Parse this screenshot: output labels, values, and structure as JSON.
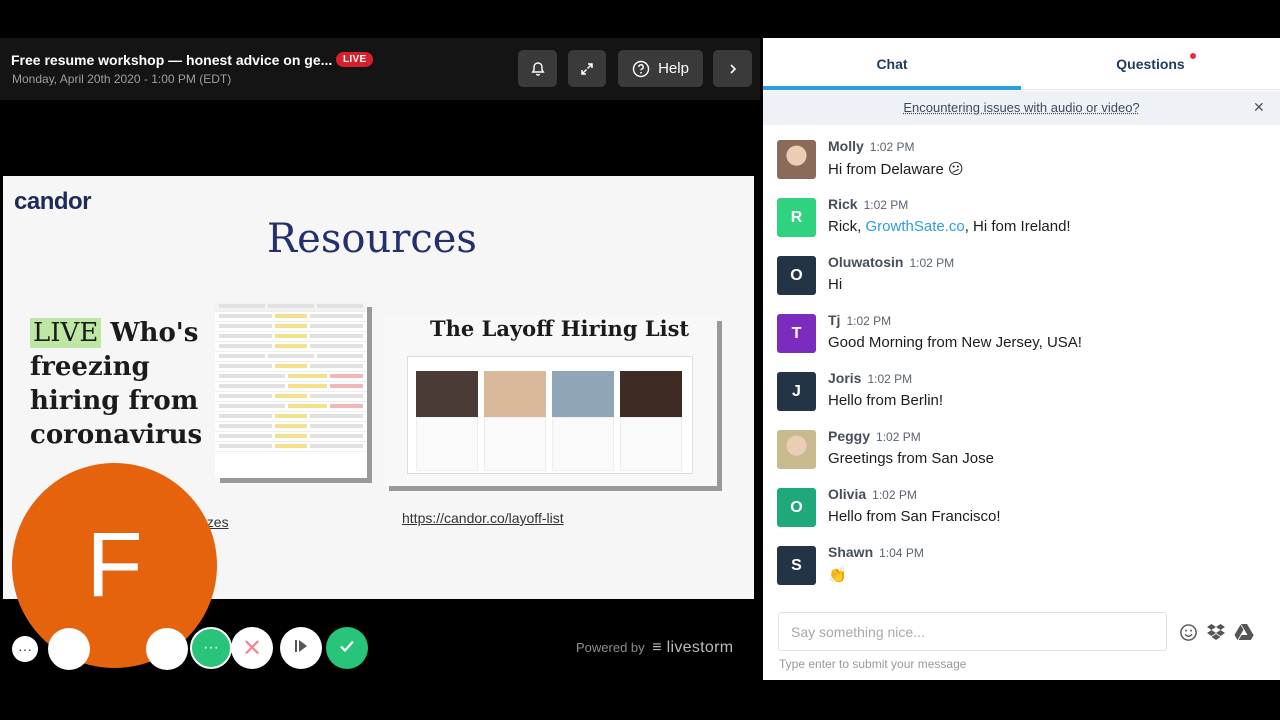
{
  "event": {
    "title": "Free resume workshop — honest advice on ge...",
    "live_badge": "LIVE",
    "date": "Monday, April 20th 2020 - 1:00 PM (EDT)",
    "help_label": "Help"
  },
  "slide": {
    "logo": "candor",
    "title": "Resources",
    "article_live": "LIVE",
    "article_rest": " Who's freezing hiring from coronavirus",
    "layoff_title": "The Layoff Hiring List",
    "link_layoff": "https://candor.co/layoff-list",
    "link_freezes": "ezes"
  },
  "presenter": {
    "avatar_letter": "F",
    "avatar_color": "#e5630d"
  },
  "controls": {
    "more_label": "···",
    "chat_label": "···",
    "close_label": "✕"
  },
  "powered": {
    "prefix": "Powered by",
    "brand": "livestorm"
  },
  "chat": {
    "tabs": [
      {
        "label": "Chat",
        "active": true
      },
      {
        "label": "Questions",
        "active": false,
        "has_notification": true
      }
    ],
    "notice": "Encountering issues with audio or video?",
    "messages": [
      {
        "name": "Molly",
        "time": "1:02 PM",
        "text": "Hi from Delaware 😕",
        "avatar": "photo",
        "color": "#8a6b5a"
      },
      {
        "name": "Rick",
        "time": "1:02 PM",
        "text_before": "Rick, ",
        "link": "GrowthSate.co",
        "text_after": ", Hi fom Ireland!",
        "avatar": "R",
        "color": "#2fd37f"
      },
      {
        "name": "Oluwatosin",
        "time": "1:02 PM",
        "text": "Hi",
        "avatar": "O",
        "color": "#243447"
      },
      {
        "name": "Tj",
        "time": "1:02 PM",
        "text": "Good Morning from New Jersey, USA!",
        "avatar": "T",
        "color": "#7b2cbf"
      },
      {
        "name": "Joris",
        "time": "1:02 PM",
        "text": "Hello from Berlin!",
        "avatar": "J",
        "color": "#243447"
      },
      {
        "name": "Peggy",
        "time": "1:02 PM",
        "text": "Greetings from San Jose",
        "avatar": "photo",
        "color": "#c9b98f"
      },
      {
        "name": "Olivia",
        "time": "1:02 PM",
        "text": "Hello from San Francisco!",
        "avatar": "O",
        "color": "#1fa97a"
      },
      {
        "name": "Shawn",
        "time": "1:04 PM",
        "text": "👏",
        "avatar": "S",
        "color": "#243447"
      }
    ],
    "composer_placeholder": "Say something nice...",
    "composer_hint": "Type enter to submit your message"
  }
}
